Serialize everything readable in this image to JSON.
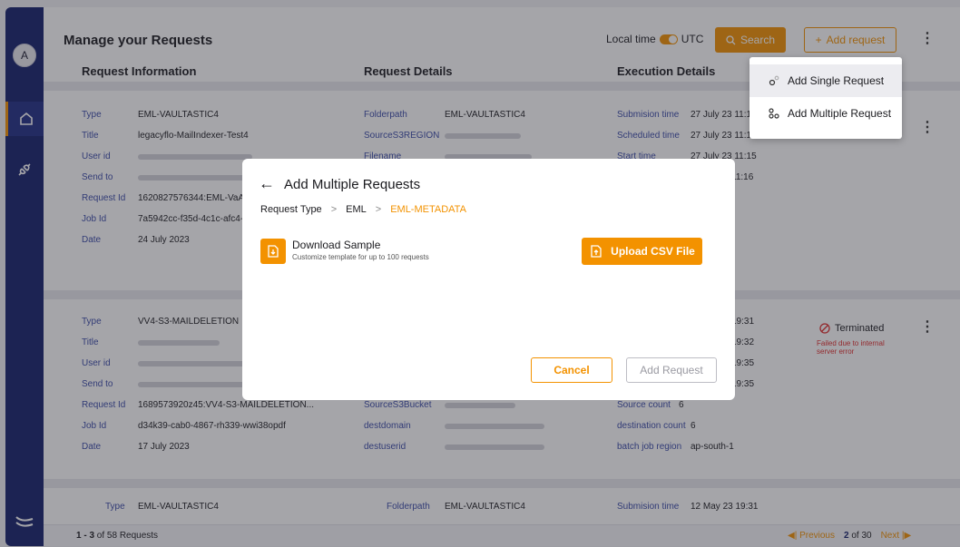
{
  "sidebar": {
    "avatar_initial": "A"
  },
  "header": {
    "title": "Manage your Requests",
    "toggle_left": "Local time",
    "toggle_right": "UTC",
    "search_label": "Search",
    "add_request_label": "Add request"
  },
  "columns": [
    "Request Information",
    "Request Details",
    "Execution Details"
  ],
  "cards": [
    {
      "info": [
        {
          "label": "Type",
          "value": "EML-VAULTASTIC4"
        },
        {
          "label": "Title",
          "value": "legacyflo-MailIndexer-Test4"
        },
        {
          "label": "User id",
          "value": ""
        },
        {
          "label": "Send to",
          "value": ""
        },
        {
          "label": "Request Id",
          "value": "1620827576344:EML-VaAt"
        },
        {
          "label": "Job Id",
          "value": "7a5942cc-f35d-4c1c-afc4-"
        },
        {
          "label": "Date",
          "value": "24 July 2023"
        }
      ],
      "details": [
        {
          "label": "Folderpath",
          "value": "EML-VAULTASTIC4"
        },
        {
          "label": "SourceS3REGION",
          "value": ""
        },
        {
          "label": "Filename",
          "value": ""
        }
      ],
      "execution": [
        {
          "label": "Submision time",
          "value": "27 July 23 11:1"
        },
        {
          "label": "Scheduled time",
          "value": "27 July 23 11:1."
        },
        {
          "label": "Start time",
          "value": "27 July 23 11:15"
        },
        {
          "label": "",
          "value": "11:16"
        }
      ]
    },
    {
      "info": [
        {
          "label": "Type",
          "value": "VV4-S3-MAILDELETION"
        },
        {
          "label": "Title",
          "value": ""
        },
        {
          "label": "User id",
          "value": ""
        },
        {
          "label": "Send to",
          "value": ""
        },
        {
          "label": "Request Id",
          "value": "1689573920z45:VV4-S3-MAILDELETION..."
        },
        {
          "label": "Job Id",
          "value": "d34k39-cab0-4867-rh339-wwi38opdf"
        },
        {
          "label": "Date",
          "value": "17 July 2023"
        }
      ],
      "details": [
        {
          "label": "SourceS3Bucket",
          "value": ""
        },
        {
          "label": "destdomain",
          "value": ""
        },
        {
          "label": "destuserid",
          "value": ""
        }
      ],
      "execution": [
        {
          "label": "",
          "value": "19:31"
        },
        {
          "label": "",
          "value": "19:32"
        },
        {
          "label": "",
          "value": "19:35"
        },
        {
          "label": "",
          "value": "19:35"
        },
        {
          "label": "Source count",
          "value": "6"
        },
        {
          "label": "destination count",
          "value": "6"
        },
        {
          "label": "batch job region",
          "value": "ap-south-1"
        }
      ],
      "status": "Terminated",
      "status_note": "Failed due to internal server error"
    },
    {
      "info": [
        {
          "label": "Type",
          "value": "EML-VAULTASTIC4"
        }
      ],
      "details": [
        {
          "label": "Folderpath",
          "value": "EML-VAULTASTIC4"
        }
      ],
      "execution": [
        {
          "label": "Submision time",
          "value": "12 May 23 19:31"
        }
      ]
    }
  ],
  "footer": {
    "range": "1 - 3",
    "range_suffix": " of 58 Requests",
    "previous": "Previous",
    "page_current": "2",
    "page_total": "of 30",
    "next": "Next"
  },
  "menu": {
    "items": [
      "Add Single Request",
      "Add Multiple Request"
    ]
  },
  "modal": {
    "title": "Add Multiple Requests",
    "breadcrumb": [
      "Request Type",
      "EML",
      "EML-METADATA"
    ],
    "download_title": "Download Sample",
    "download_subtitle": "Customize template for up to 100 requests",
    "upload_label": "Upload CSV File",
    "cancel_label": "Cancel",
    "add_label": "Add Request"
  },
  "colors": {
    "accent": "#f39200",
    "sidebar": "#14206b",
    "label_blue": "#3a4aa8",
    "error": "#e02b2b"
  }
}
